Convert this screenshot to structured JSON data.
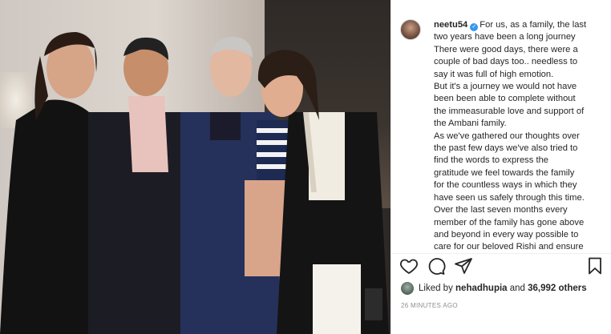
{
  "post": {
    "username": "neetu54",
    "verified": true,
    "caption_lines": [
      "For us, as a family, the last",
      "two years have been a long journey",
      "There were good days, there were a",
      "couple of bad days too.. needless to",
      "say it was full of high emotion.",
      "But it's a journey we would not have",
      "been been able to complete without",
      "the immeasurable love and support of",
      "the Ambani family.",
      "As we've gathered our thoughts over",
      "the past few days we've also tried to",
      "find the words to express the",
      "gratitude we feel towards the family",
      "for the countless ways in which they",
      "have seen us safely through this time.",
      "Over the last seven months every",
      "member of the family has gone above",
      "and beyond in every way possible to",
      "care for our beloved Rishi and ensure"
    ]
  },
  "actions": {
    "like_icon": "heart-icon",
    "comment_icon": "comment-icon",
    "share_icon": "paper-plane-icon",
    "save_icon": "bookmark-icon"
  },
  "likes": {
    "prefix": "Liked by ",
    "user": "nehadhupia",
    "middle": " and ",
    "count": "36,992 others"
  },
  "timestamp": "26 MINUTES AGO",
  "colors": {
    "text": "#262626",
    "muted": "#8e8e8e",
    "verified_blue": "#3897f0",
    "divider": "#efefef"
  }
}
